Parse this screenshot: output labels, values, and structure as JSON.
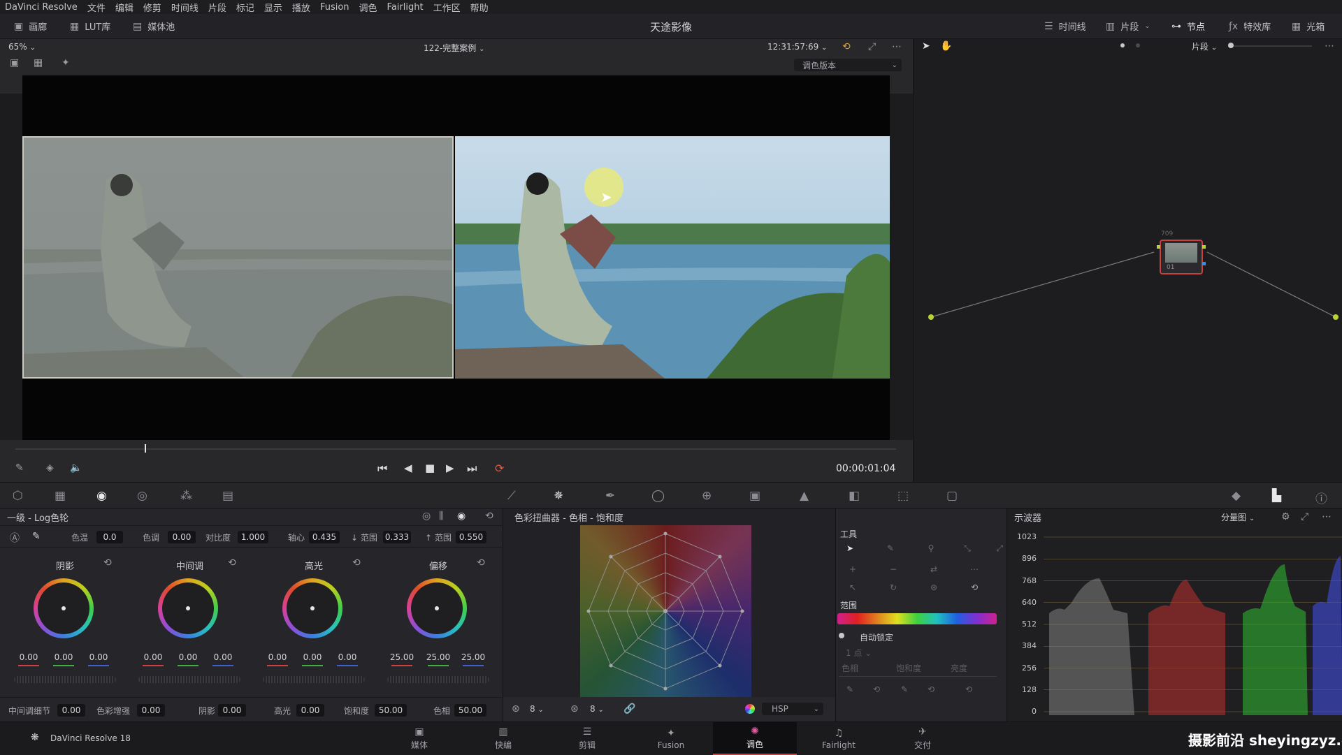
{
  "menubar": {
    "items": [
      "DaVinci Resolve",
      "文件",
      "编辑",
      "修剪",
      "时间线",
      "片段",
      "标记",
      "显示",
      "播放",
      "Fusion",
      "调色",
      "Fairlight",
      "工作区",
      "帮助"
    ]
  },
  "toolbar": {
    "gallery": "画廊",
    "lut": "LUT库",
    "media_pool": "媒体池",
    "project_title": "天途影像",
    "timeline": "时间线",
    "clips": "片段",
    "nodes": "节点",
    "effects": "特效库",
    "lightbox": "光箱"
  },
  "viewer": {
    "zoom": "65%",
    "clip_name": "122-完整案例",
    "timecode_top": "12:31:57:69",
    "version_dropdown": "调色版本",
    "timecode": "00:00:01:04",
    "playhead_fraction": 0.147
  },
  "nodes": {
    "mode": "片段",
    "node_label": "01",
    "node_top_label": "709"
  },
  "wheels": {
    "title": "一级 - Log色轮",
    "params": [
      {
        "label": "色温",
        "value": "0.0"
      },
      {
        "label": "色调",
        "value": "0.00"
      },
      {
        "label": "对比度",
        "value": "1.000"
      },
      {
        "label": "轴心",
        "value": "0.435"
      },
      {
        "label": "↓ 范围",
        "value": "0.333"
      },
      {
        "label": "↑ 范围",
        "value": "0.550"
      }
    ],
    "groups": [
      {
        "name": "阴影",
        "values": [
          "0.00",
          "0.00",
          "0.00"
        ]
      },
      {
        "name": "中间调",
        "values": [
          "0.00",
          "0.00",
          "0.00"
        ]
      },
      {
        "name": "高光",
        "values": [
          "0.00",
          "0.00",
          "0.00"
        ]
      },
      {
        "name": "偏移",
        "values": [
          "25.00",
          "25.00",
          "25.00"
        ]
      }
    ],
    "bottom": [
      {
        "label": "中间调细节",
        "value": "0.00"
      },
      {
        "label": "色彩增强",
        "value": "0.00"
      },
      {
        "label": "阴影",
        "value": "0.00"
      },
      {
        "label": "高光",
        "value": "0.00"
      },
      {
        "label": "饱和度",
        "value": "50.00"
      },
      {
        "label": "色相",
        "value": "50.00"
      }
    ]
  },
  "warper": {
    "title": "色彩扭曲器 - 色相 - 饱和度",
    "grid_a": "8",
    "grid_b": "8",
    "mode": "HSP"
  },
  "tools": {
    "title": "工具",
    "range_title": "范围",
    "auto_lock": "自动锁定",
    "points": "1 点",
    "channels": [
      "色相",
      "饱和度",
      "亮度"
    ]
  },
  "scope": {
    "title": "示波器",
    "mode": "分量图",
    "ticks": [
      "1023",
      "896",
      "768",
      "640",
      "512",
      "384",
      "256",
      "128",
      "0"
    ]
  },
  "pagebar": {
    "app": "DaVinci Resolve 18",
    "pages": [
      "媒体",
      "快编",
      "剪辑",
      "Fusion",
      "调色",
      "Fairlight",
      "交付"
    ],
    "active": "调色"
  },
  "watermark": "摄影前沿 sheyingzyz.com"
}
